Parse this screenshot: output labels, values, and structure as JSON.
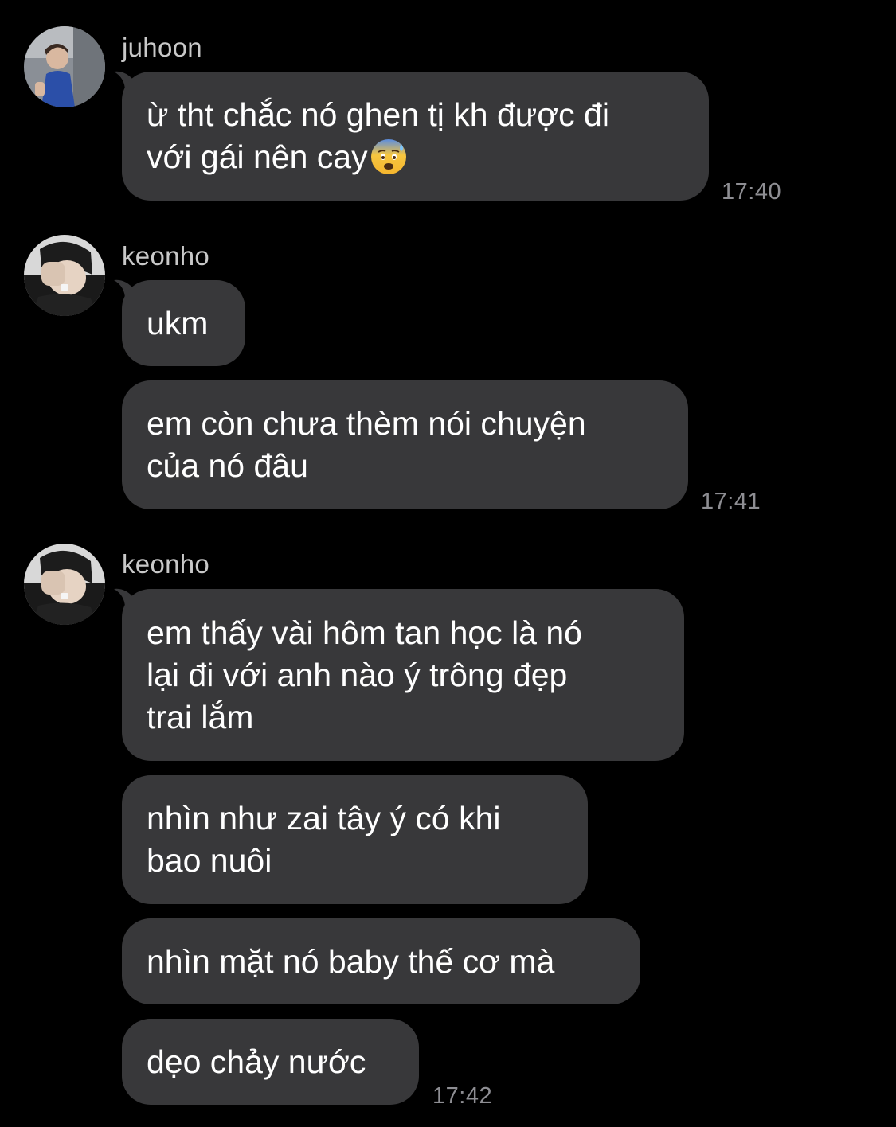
{
  "groups": [
    {
      "sender": "juhoon",
      "avatar_icon": "profile-photo-juhoon",
      "messages": [
        {
          "text": "ừ tht chắc nó ghen tị kh được đi\nvới gái nên cay",
          "emoji": "anxious-face-with-sweat"
        }
      ],
      "time": "17:40"
    },
    {
      "sender": "keonho",
      "avatar_icon": "profile-photo-keonho",
      "messages": [
        {
          "text": "ukm"
        },
        {
          "text": "em còn chưa thèm nói chuyện\ncủa nó đâu"
        }
      ],
      "time": "17:41"
    },
    {
      "sender": "keonho",
      "avatar_icon": "profile-photo-keonho",
      "messages": [
        {
          "text": "em thấy vài hôm tan học là nó\nlại đi với anh nào ý trông đẹp\ntrai lắm"
        },
        {
          "text": "nhìn như zai tây ý có khi\nbao nuôi"
        },
        {
          "text": "nhìn mặt nó baby thế cơ mà"
        },
        {
          "text": "dẹo chảy nước"
        }
      ],
      "time": "17:42"
    }
  ],
  "colors": {
    "background": "#000000",
    "bubble": "#38383a",
    "text": "#ffffff",
    "sender": "#c8c8c8",
    "timestamp": "#8e8e93"
  }
}
